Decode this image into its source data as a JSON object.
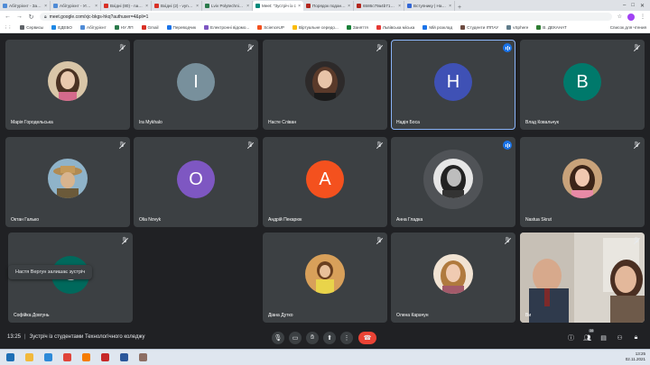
{
  "browser": {
    "tabs": [
      {
        "label": "Абітурієнт - Заява",
        "fav": "#4f8bd6"
      },
      {
        "label": "Абітурієнт - Угода абі",
        "fav": "#4f8bd6"
      },
      {
        "label": "Вхідні (80) - nadiaboc",
        "fav": "#d93025"
      },
      {
        "label": "Вхідні (2) - vynachatel",
        "fav": "#d93025"
      },
      {
        "label": "Lviv Polytechnic Nation",
        "fav": "#2b7a4b"
      },
      {
        "label": "Meet: \"Зустріч із с",
        "fav": "#00897b",
        "active": true
      },
      {
        "label": "Порядок подання зая",
        "fav": "#b3261e"
      },
      {
        "label": "6586c79a4b71808846",
        "fav": "#b3261e"
      },
      {
        "label": "Вступнику | Націонал",
        "fav": "#3367d6"
      }
    ],
    "url": "meet.google.com/xjc-bkgs-hkq?authuser=4&pli=1",
    "bookmarks": [
      {
        "label": "Сервисы",
        "fav": "#5f6368"
      },
      {
        "label": "ЕДЕБО",
        "fav": "#1e88e5"
      },
      {
        "label": "Абітурієнт",
        "fav": "#4f8bd6"
      },
      {
        "label": "НУ ЛП",
        "fav": "#2b7a4b"
      },
      {
        "label": "Gmail",
        "fav": "#d93025"
      },
      {
        "label": "Переводчик",
        "fav": "#1a73e8"
      },
      {
        "label": "Електронні відомо...",
        "fav": "#7e57c2"
      },
      {
        "label": "ScienceUP",
        "fav": "#f4511e"
      },
      {
        "label": "Віртуальне середо...",
        "fav": "#fbbc04"
      },
      {
        "label": "Заняття",
        "fav": "#188038"
      },
      {
        "label": "Львівська міська",
        "fav": "#e53935"
      },
      {
        "label": "Мій розклад",
        "fav": "#1a73e8"
      },
      {
        "label": "Студенти ІППАУ",
        "fav": "#6d4c41"
      },
      {
        "label": "vSphere",
        "fav": "#607d8b"
      },
      {
        "label": "В. ДЕКАНАТ",
        "fav": "#2e7d32"
      }
    ],
    "bookmarks_other": "Список для чтения"
  },
  "participants": [
    {
      "name": "Марія Городельська",
      "kind": "photo",
      "photo": "p1",
      "muted": true
    },
    {
      "name": "Ira Mykhalo",
      "kind": "letter",
      "letter": "I",
      "color": "#78909c",
      "muted": true
    },
    {
      "name": "Насте Сліван",
      "kind": "photo",
      "photo": "p2",
      "muted": true
    },
    {
      "name": "Надія Боса",
      "kind": "letter",
      "letter": "Н",
      "color": "#3f51b5",
      "active": true,
      "speaking": true
    },
    {
      "name": "Влад Ковальчук",
      "kind": "letter",
      "letter": "В",
      "color": "#00796b",
      "muted": true
    },
    {
      "name": "Октан Галько",
      "kind": "photo",
      "photo": "p3",
      "muted": true
    },
    {
      "name": "Olia Novyk",
      "kind": "letter",
      "letter": "O",
      "color": "#7e57c2",
      "muted": true
    },
    {
      "name": "Андрій Пекарюк",
      "kind": "letter",
      "letter": "А",
      "color": "#f4511e",
      "muted": true
    },
    {
      "name": "Анна Гладка",
      "kind": "photo",
      "photo": "p4",
      "active": true
    },
    {
      "name": "Nastua Skrut",
      "kind": "photo",
      "photo": "p5",
      "muted": true
    },
    {
      "name": "Софійка Довгунь",
      "kind": "letter",
      "letter": "C",
      "color": "#00695c",
      "muted": true
    },
    {
      "name": "Діана Дутко",
      "kind": "photo",
      "photo": "p6",
      "muted": true
    },
    {
      "name": "Олена Карачун",
      "kind": "photo",
      "photo": "p7",
      "muted": true
    },
    {
      "name": "Ви",
      "kind": "video",
      "muted": true
    }
  ],
  "notice": "Настя Вергун залишає зустріч",
  "meeting": {
    "time": "13:25",
    "title": "Зустріч із студентами Технологічного коледжу",
    "participant_count": "14"
  },
  "controls": [
    "mic-icon",
    "camera-icon",
    "raise-hand-icon",
    "present-icon",
    "more-icon",
    "hangup-icon"
  ],
  "side_controls": [
    "info-icon",
    "people-icon",
    "chat-icon",
    "activities-icon",
    "lock-icon"
  ],
  "taskbar": {
    "apps": [
      {
        "name": "start-button",
        "color": "#1f6fb5"
      },
      {
        "name": "file-explorer-icon",
        "color": "#f2b93b"
      },
      {
        "name": "internet-explorer-icon",
        "color": "#2e8ad8"
      },
      {
        "name": "chrome-icon",
        "color": "#e0443a"
      },
      {
        "name": "firefox-icon",
        "color": "#f57c00"
      },
      {
        "name": "acrobat-icon",
        "color": "#c62828"
      },
      {
        "name": "word-icon",
        "color": "#2b579a"
      },
      {
        "name": "paint-icon",
        "color": "#8d6e63"
      }
    ],
    "time": "13:25",
    "date": "02.11.2021"
  }
}
